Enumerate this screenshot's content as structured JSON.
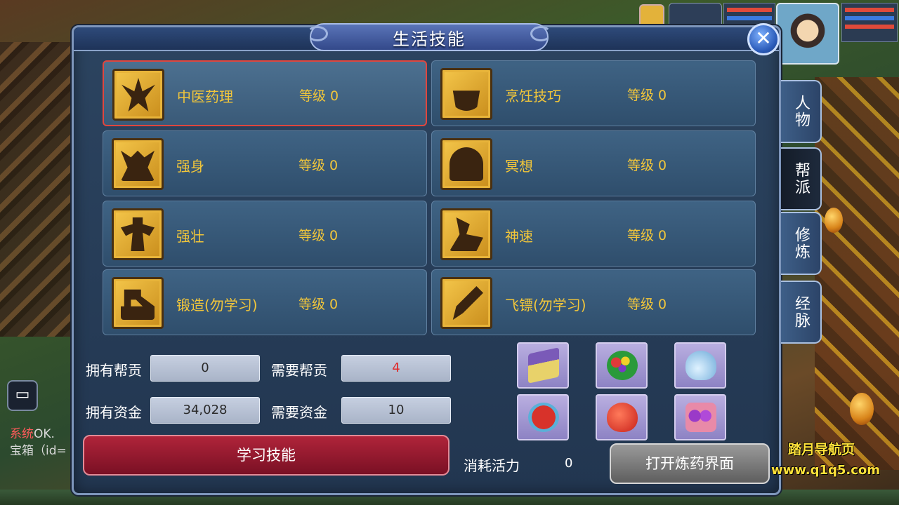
{
  "window": {
    "title": "生活技能",
    "close_label": "✕"
  },
  "side_tabs": [
    {
      "label": "人物",
      "active": false
    },
    {
      "label": "帮派",
      "active": true
    },
    {
      "label": "修炼",
      "active": false
    },
    {
      "label": "经脉",
      "active": false
    }
  ],
  "skills": [
    {
      "name": "中医药理",
      "level_label": "等级 0",
      "icon": "herb-medicine-icon",
      "selected": true
    },
    {
      "name": "烹饪技巧",
      "level_label": "等级 0",
      "icon": "cooking-pot-icon",
      "selected": false
    },
    {
      "name": "强身",
      "level_label": "等级 0",
      "icon": "strong-body-icon",
      "selected": false
    },
    {
      "name": "冥想",
      "level_label": "等级 0",
      "icon": "meditation-icon",
      "selected": false
    },
    {
      "name": "强壮",
      "level_label": "等级 0",
      "icon": "muscle-icon",
      "selected": false
    },
    {
      "name": "神速",
      "level_label": "等级 0",
      "icon": "swift-speed-icon",
      "selected": false
    },
    {
      "name": "锻造(勿学习)",
      "level_label": "等级 0",
      "icon": "forge-hammer-icon",
      "selected": false
    },
    {
      "name": "飞镖(勿学习)",
      "level_label": "等级 0",
      "icon": "dart-icon",
      "selected": false
    }
  ],
  "info": {
    "owned_contribution_label": "拥有帮贡",
    "owned_contribution_value": "0",
    "required_contribution_label": "需要帮贡",
    "required_contribution_value": "4",
    "owned_funds_label": "拥有资金",
    "owned_funds_value": "34,028",
    "required_funds_label": "需要资金",
    "required_funds_value": "10"
  },
  "items": [
    {
      "icon": "gift-box-icon",
      "color": "#e8d26a"
    },
    {
      "icon": "fruit-plate-icon",
      "color": "#3aa83a"
    },
    {
      "icon": "potion-bottle-icon",
      "color": "#8ec8ee"
    },
    {
      "icon": "rouge-dish-icon",
      "color": "#d8322a"
    },
    {
      "icon": "red-pouch-icon",
      "color": "#e0402a"
    },
    {
      "icon": "purple-pills-icon",
      "color": "#9a3ac8"
    }
  ],
  "actions": {
    "learn_label": "学习技能",
    "consume_label": "消耗活力",
    "consume_value": "0",
    "alchemy_label": "打开炼药界面"
  },
  "chat": {
    "system_tag": "系统",
    "line1": "OK.",
    "line2": "宝箱（id="
  },
  "watermark": {
    "line1": "踏月导航页",
    "line2": "www.q1q5.com"
  },
  "colors": {
    "accent_gold": "#f2c63a",
    "learn_button": "#b0243a",
    "required_red": "#e02a2a"
  }
}
